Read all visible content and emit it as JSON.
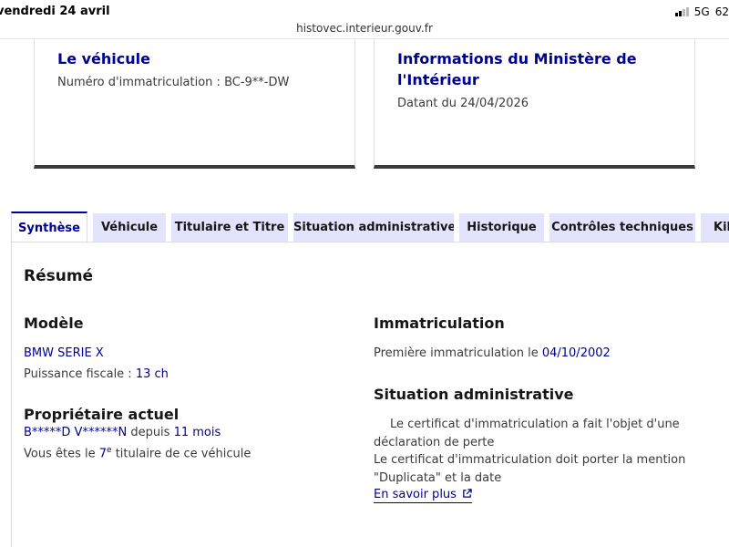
{
  "status_bar": {
    "time": "vendredi 24 avril",
    "network": "5G",
    "battery": "62"
  },
  "browser": {
    "url": "histovec.interieur.gouv.fr"
  },
  "cards": [
    {
      "title": "Le véhicule",
      "text": "Numéro d'immatriculation : BC-9**-DW"
    },
    {
      "title": "Informations du Ministère de l'Intérieur",
      "text": "Datant du 24/04/2026"
    }
  ],
  "tabs": [
    {
      "label": "Synthèse",
      "active": true
    },
    {
      "label": "Véhicule",
      "active": false
    },
    {
      "label": "Titulaire et Titre",
      "active": false
    },
    {
      "label": "Situation administrative",
      "active": false
    },
    {
      "label": "Historique",
      "active": false
    },
    {
      "label": "Contrôles techniques",
      "active": false
    },
    {
      "label": "Kilométrage",
      "active": false
    }
  ],
  "summary": {
    "heading": "Résumé",
    "modele": {
      "heading": "Modèle",
      "model_name": "BMW SERIE X",
      "puissance_label": "Puissance fiscale : ",
      "puissance_value": "13 ch"
    },
    "proprietaire": {
      "heading": "Propriétaire actuel",
      "name": "B*****D V******N",
      "since_label": " depuis ",
      "since_value": "11 mois",
      "rank_prefix": "Vous êtes le ",
      "rank_number": "7",
      "rank_suffix": "e",
      "rank_tail": " titulaire de ce véhicule"
    },
    "immatriculation": {
      "heading": "Immatriculation",
      "first_label": "Première immatriculation le ",
      "first_date": "04/10/2002"
    },
    "situation": {
      "heading": "Situation administrative",
      "line1": "Le certificat d'immatriculation a fait l'objet d'une déclaration de perte",
      "line2": "Le certificat d'immatriculation doit porter la mention \"Duplicata\" et la date",
      "link": "En savoir plus"
    }
  },
  "colors": {
    "brand_blue": "#000091",
    "tab_bg": "#e3e3fd",
    "text": "#161616",
    "card_border": "#3a3a3a"
  }
}
